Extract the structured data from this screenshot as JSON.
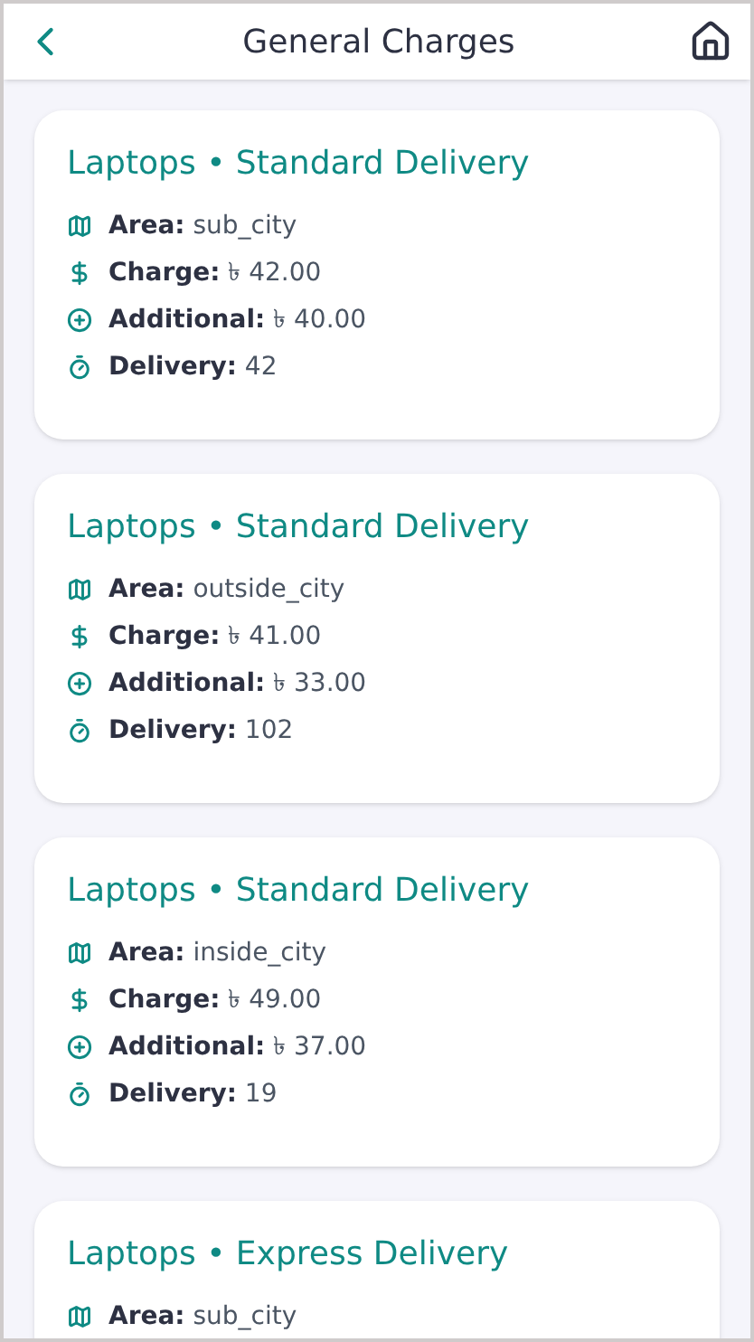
{
  "header": {
    "title": "General Charges"
  },
  "cards": [
    {
      "title": "Laptops • Standard Delivery",
      "fields": [
        {
          "kind": "area",
          "label": "Area:",
          "value": "sub_city"
        },
        {
          "kind": "charge",
          "label": "Charge:",
          "value": "৳ 42.00"
        },
        {
          "kind": "additional",
          "label": "Additional:",
          "value": "৳ 40.00"
        },
        {
          "kind": "delivery",
          "label": "Delivery:",
          "value": "42"
        }
      ]
    },
    {
      "title": "Laptops • Standard Delivery",
      "fields": [
        {
          "kind": "area",
          "label": "Area:",
          "value": "outside_city"
        },
        {
          "kind": "charge",
          "label": "Charge:",
          "value": "৳ 41.00"
        },
        {
          "kind": "additional",
          "label": "Additional:",
          "value": "৳ 33.00"
        },
        {
          "kind": "delivery",
          "label": "Delivery:",
          "value": "102"
        }
      ]
    },
    {
      "title": "Laptops • Standard Delivery",
      "fields": [
        {
          "kind": "area",
          "label": "Area:",
          "value": "inside_city"
        },
        {
          "kind": "charge",
          "label": "Charge:",
          "value": "৳ 49.00"
        },
        {
          "kind": "additional",
          "label": "Additional:",
          "value": "৳ 37.00"
        },
        {
          "kind": "delivery",
          "label": "Delivery:",
          "value": "19"
        }
      ]
    },
    {
      "title": "Laptops • Express Delivery",
      "fields": [
        {
          "kind": "area",
          "label": "Area:",
          "value": "sub_city"
        }
      ]
    }
  ]
}
